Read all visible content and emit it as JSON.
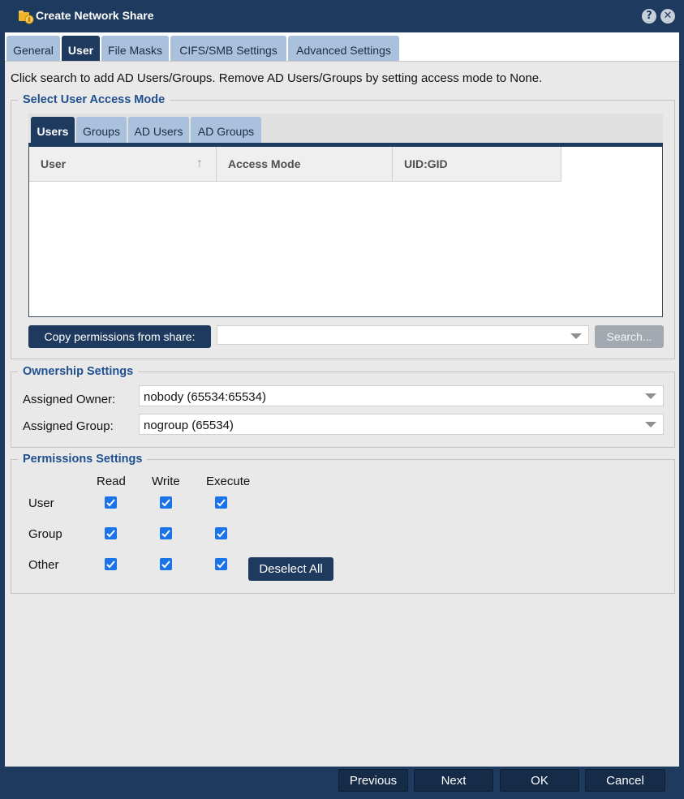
{
  "window": {
    "title": "Create Network Share",
    "help_glyph": "?",
    "close_glyph": "✕"
  },
  "tabs": [
    "General",
    "User",
    "File Masks",
    "CIFS/SMB Settings",
    "Advanced Settings"
  ],
  "instruction": "Click search to add AD Users/Groups. Remove AD Users/Groups by setting access mode to None.",
  "access_mode": {
    "legend": "Select User Access Mode",
    "tabs": [
      "Users",
      "Groups",
      "AD Users",
      "AD Groups"
    ],
    "columns": [
      "User",
      "Access Mode",
      "UID:GID"
    ],
    "sort_glyph": "↑",
    "copy_button": "Copy permissions from share:",
    "share_value": "",
    "search_button": "Search..."
  },
  "ownership": {
    "legend": "Ownership Settings",
    "owner_label": "Assigned Owner:",
    "owner_value": "nobody (65534:65534)",
    "group_label": "Assigned Group:",
    "group_value": "nogroup (65534)"
  },
  "permissions": {
    "legend": "Permissions Settings",
    "columns": [
      "Read",
      "Write",
      "Execute"
    ],
    "rows": [
      "User",
      "Group",
      "Other"
    ],
    "deselect_button": "Deselect All"
  },
  "footer": {
    "previous": "Previous",
    "next": "Next",
    "ok": "OK",
    "cancel": "Cancel"
  },
  "colors": {
    "accent": "#1f3a5f",
    "tab_inactive": "#a9c1dc",
    "legend": "#1f4f8f",
    "checkbox": "#1a73e8"
  }
}
